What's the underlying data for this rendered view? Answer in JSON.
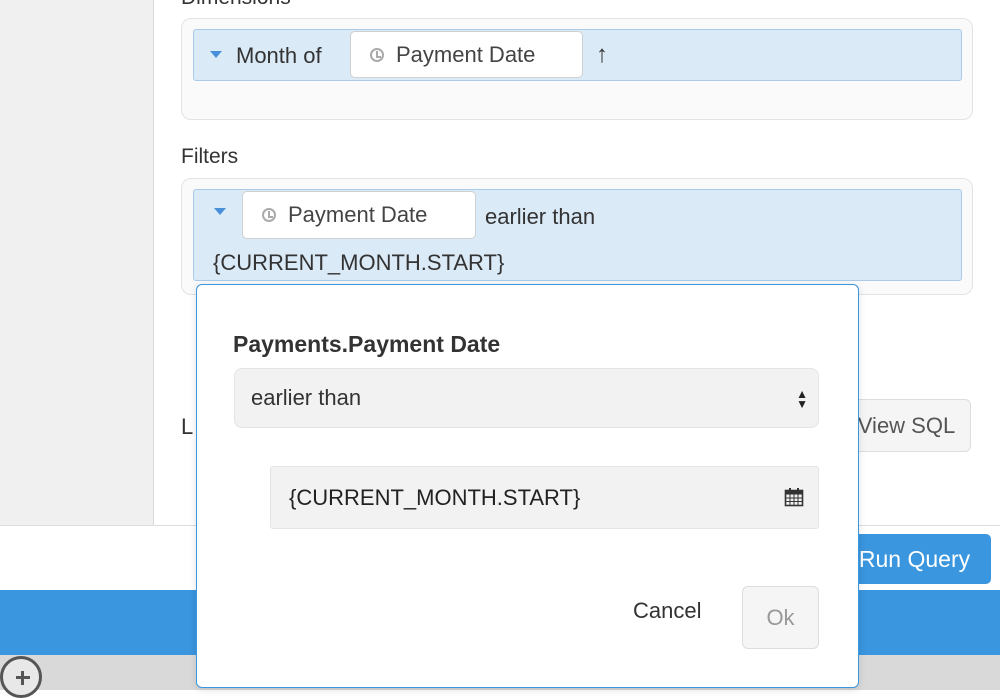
{
  "dimensions": {
    "label": "Dimensions",
    "prefix": "Month of",
    "field": "Payment Date",
    "sort_arrow": "↑"
  },
  "filters": {
    "label": "Filters",
    "field": "Payment Date",
    "operator": "earlier than",
    "value": "{CURRENT_MONTH.START}"
  },
  "limit_label_partial": "L",
  "view_sql_label": "View SQL",
  "run_query_label": "Run Query",
  "popover": {
    "title": "Payments.Payment Date",
    "operator_selected": "earlier than",
    "date_value": "{CURRENT_MONTH.START}",
    "cancel_label": "Cancel",
    "ok_label": "Ok"
  },
  "colors": {
    "accent": "#3a96df",
    "pill_bg": "#dbeaf7"
  },
  "icons": [
    "clock-icon",
    "caret-down-icon",
    "calendar-icon",
    "select-arrows-icon",
    "add-circle-icon",
    "sort-ascending-icon"
  ]
}
